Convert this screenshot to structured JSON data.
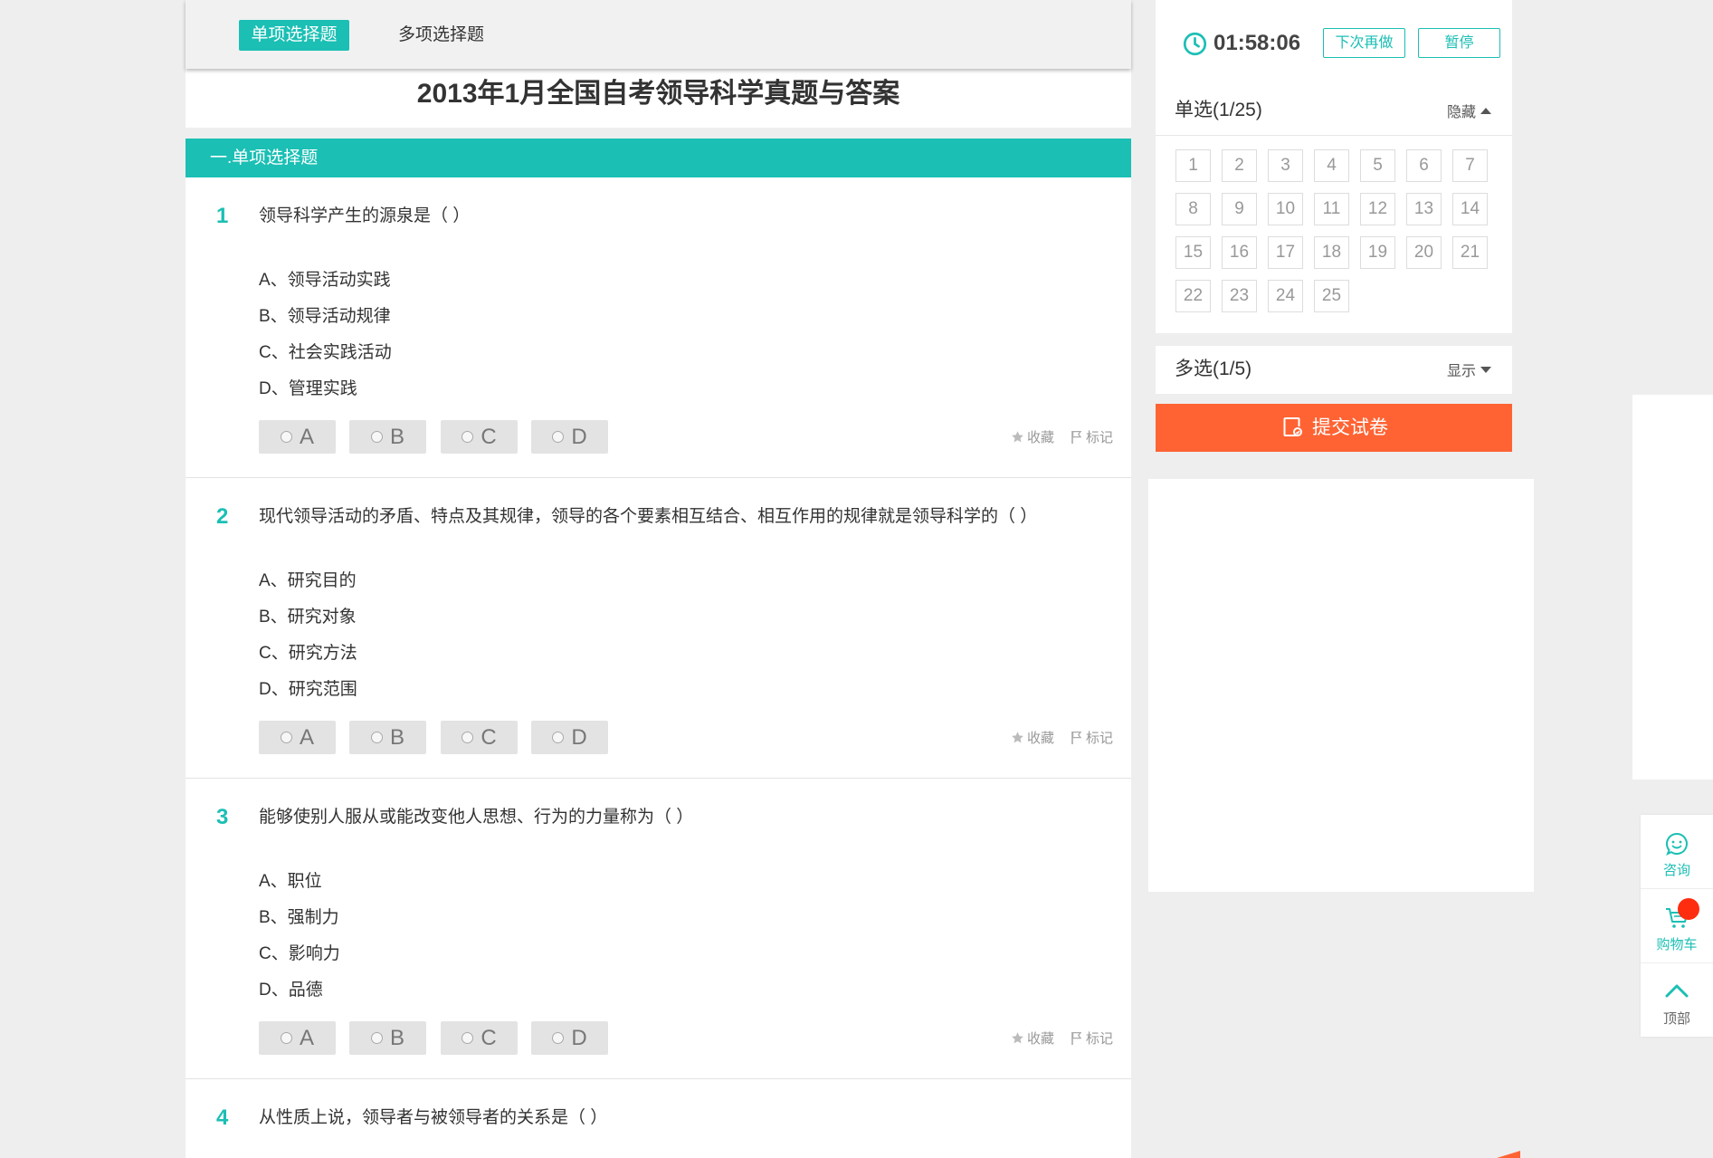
{
  "tabs": [
    {
      "label": "单项选择题",
      "active": true
    },
    {
      "label": "多项选择题",
      "active": false
    }
  ],
  "paper_title": "2013年1月全国自考领导科学真题与答案",
  "section_title": "一.单项选择题",
  "questions": [
    {
      "number": "1",
      "text": "领导科学产生的源泉是（ ）",
      "options": [
        "A、领导活动实践",
        "B、领导活动规律",
        "C、社会实践活动",
        "D、管理实践"
      ]
    },
    {
      "number": "2",
      "text": "现代领导活动的矛盾、特点及其规律，领导的各个要素相互结合、相互作用的规律就是领导科学的（ ）",
      "options": [
        "A、研究目的",
        "B、研究对象",
        "C、研究方法",
        "D、研究范围"
      ]
    },
    {
      "number": "3",
      "text": "能够使别人服从或能改变他人思想、行为的力量称为（ ）",
      "options": [
        "A、职位",
        "B、强制力",
        "C、影响力",
        "D、品德"
      ]
    },
    {
      "number": "4",
      "text": "从性质上说，领导者与被领导者的关系是（ ）"
    }
  ],
  "answer_choices": [
    "A",
    "B",
    "C",
    "D"
  ],
  "actions": {
    "favorite": "收藏",
    "favorite_icon": "star-icon",
    "mark": "标记",
    "mark_icon": "flag-icon"
  },
  "timer": {
    "icon": "clock-icon",
    "time": "01:58:06",
    "redo_label": "下次再做",
    "pause_label": "暂停"
  },
  "single_choice": {
    "title": "单选(1/25)",
    "toggle": "隐藏",
    "toggle_icon": "caret-up-icon",
    "numbers": [
      "1",
      "2",
      "3",
      "4",
      "5",
      "6",
      "7",
      "8",
      "9",
      "10",
      "11",
      "12",
      "13",
      "14",
      "15",
      "16",
      "17",
      "18",
      "19",
      "20",
      "21",
      "22",
      "23",
      "24",
      "25"
    ]
  },
  "multi_choice": {
    "title": "多选(1/5)",
    "toggle": "显示",
    "toggle_icon": "caret-down-icon"
  },
  "submit": {
    "label": "提交试卷",
    "icon": "edit-document-icon"
  },
  "float_bar": [
    {
      "label": "咨询",
      "icon": "chat-smile-icon"
    },
    {
      "label": "购物车",
      "icon": "cart-icon",
      "badge": true
    },
    {
      "label": "顶部",
      "icon": "chevron-up-icon"
    }
  ],
  "colors": {
    "accent": "#1bbfb4",
    "submit": "#ff6333",
    "badge": "#ff2d0f",
    "background": "#eeeeee"
  }
}
